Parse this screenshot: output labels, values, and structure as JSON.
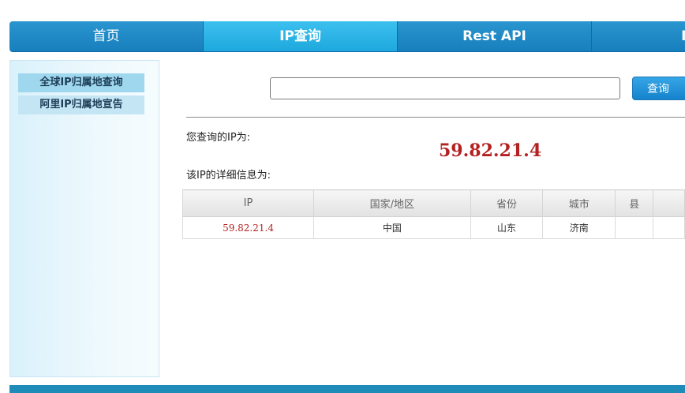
{
  "nav": {
    "items": [
      {
        "label": "首页"
      },
      {
        "label": "IP查询"
      },
      {
        "label": "Rest API"
      },
      {
        "label": "IP"
      }
    ]
  },
  "sidebar": {
    "items": [
      {
        "label": "全球IP归属地查询"
      },
      {
        "label": "阿里IP归属地宣告"
      }
    ]
  },
  "search": {
    "placeholder": "",
    "value": "",
    "button_label": "查询"
  },
  "result": {
    "query_label": "您查询的IP为:",
    "ip": "59.82.21.4",
    "detail_label": "该IP的详细信息为:"
  },
  "table": {
    "headers": [
      "IP",
      "国家/地区",
      "省份",
      "城市",
      "县",
      ""
    ],
    "rows": [
      [
        "59.82.21.4",
        "中国",
        "山东",
        "济南",
        "",
        ""
      ]
    ]
  },
  "colors": {
    "nav": "#1a86c3",
    "nav_active": "#2db4e6",
    "ip_red": "#b52020"
  }
}
